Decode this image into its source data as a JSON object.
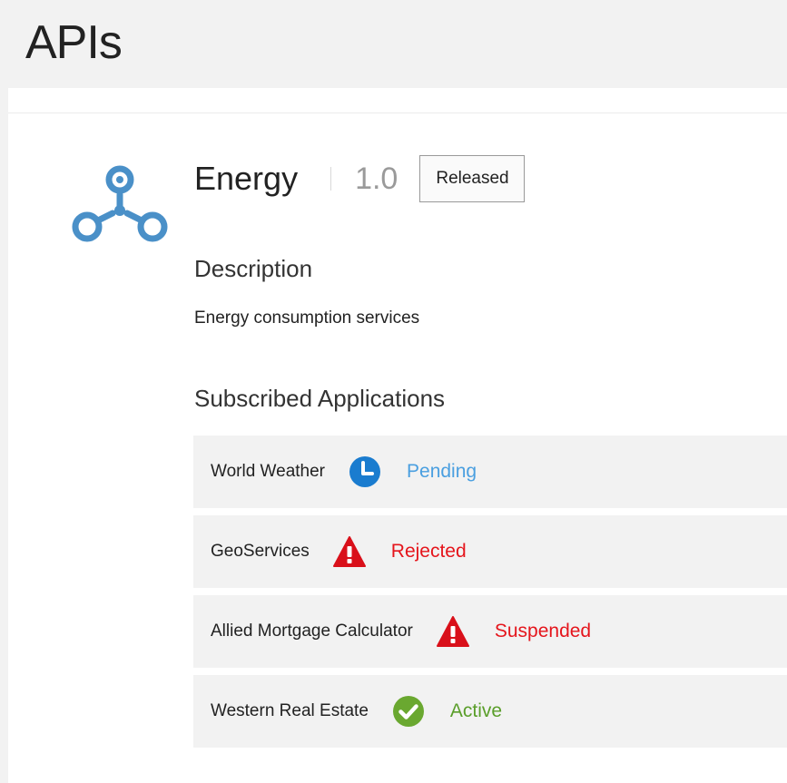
{
  "page": {
    "title": "APIs"
  },
  "api": {
    "icon": "api-network-icon",
    "name": "Energy",
    "version": "1.0",
    "status": "Released",
    "description_heading": "Description",
    "description": "Energy consumption services",
    "subscribed_heading": "Subscribed Applications"
  },
  "subscriptions": [
    {
      "name": "World Weather",
      "status": "Pending",
      "icon": "clock-icon",
      "color": "#4a9fe0"
    },
    {
      "name": "GeoServices",
      "status": "Rejected",
      "icon": "warning-icon",
      "color": "#e5151c"
    },
    {
      "name": "Allied Mortgage Calculator",
      "status": "Suspended",
      "icon": "warning-icon",
      "color": "#e5151c"
    },
    {
      "name": "Western Real Estate",
      "status": "Active",
      "icon": "check-circle-icon",
      "color": "#5a9e2a"
    }
  ],
  "colors": {
    "brand_blue": "#4a90c8",
    "clock_blue": "#1a7ccf",
    "warning_red": "#d9101a",
    "check_green": "#6aa830"
  }
}
